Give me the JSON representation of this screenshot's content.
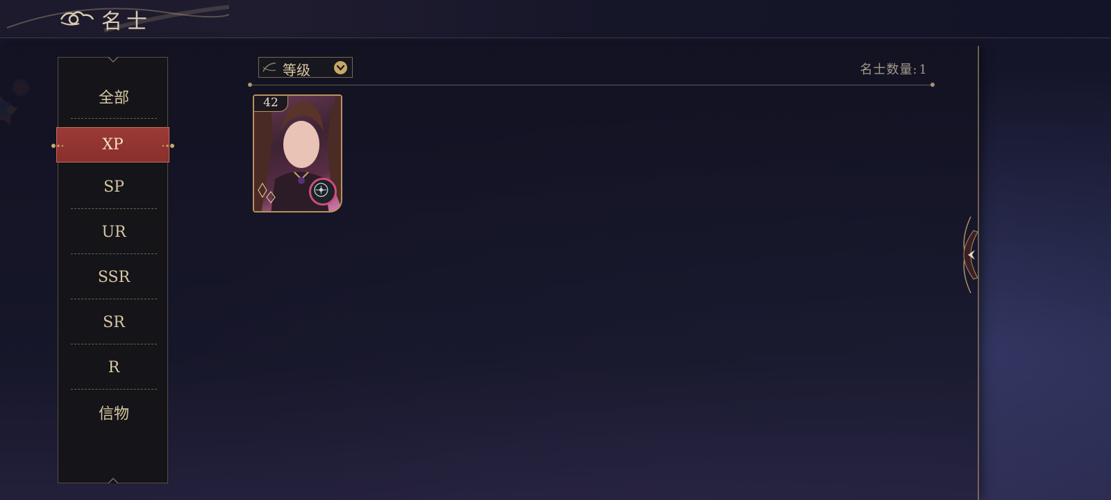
{
  "header": {
    "title": "名士"
  },
  "sidebar": {
    "items": [
      {
        "label": "全部",
        "active": false
      },
      {
        "label": "XP",
        "active": true
      },
      {
        "label": "SP",
        "active": false
      },
      {
        "label": "UR",
        "active": false
      },
      {
        "label": "SSR",
        "active": false
      },
      {
        "label": "SR",
        "active": false
      },
      {
        "label": "R",
        "active": false
      },
      {
        "label": "信物",
        "active": false
      }
    ]
  },
  "toolbar": {
    "sort_label": "等级",
    "count_label": "名士数量:",
    "count_value": "1"
  },
  "cards": [
    {
      "level": "42"
    }
  ],
  "colors": {
    "accent_gold": "#c9a866",
    "active_tab_red": "#9b3a36",
    "text_gold": "#d8c8a2"
  }
}
